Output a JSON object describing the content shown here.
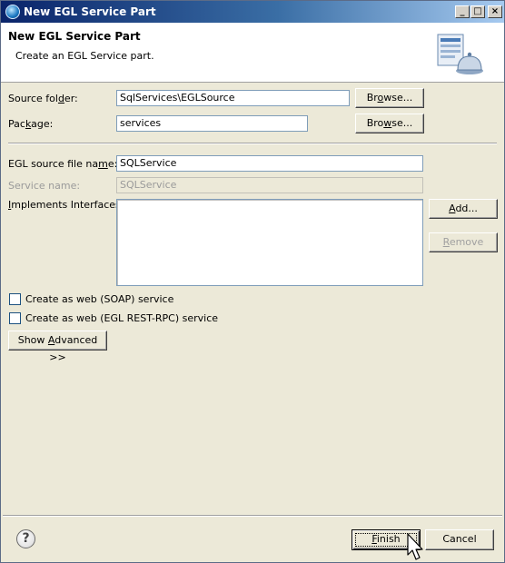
{
  "window": {
    "title": "New EGL Service Part",
    "icon": "egl-app-icon",
    "controls": {
      "minimize": "_",
      "maximize": "□",
      "close": "×"
    }
  },
  "banner": {
    "heading": "New EGL Service Part",
    "description": "Create an EGL Service part.",
    "graphic": "service-bell-icon"
  },
  "form": {
    "source_folder": {
      "label_pre": "Source fol",
      "label_u": "d",
      "label_post": "er:",
      "value": "SqlServices\\EGLSource",
      "browse_pre": "Br",
      "browse_u": "o",
      "browse_post": "wse..."
    },
    "package": {
      "label_pre": "Pac",
      "label_u": "k",
      "label_post": "age:",
      "value": "services",
      "browse_pre": "Bro",
      "browse_u": "w",
      "browse_post": "se..."
    },
    "egl_file": {
      "label_pre": "EGL source file na",
      "label_u": "m",
      "label_post": "e:",
      "value": "SQLService"
    },
    "service_name": {
      "label": "Service name:",
      "value": "SQLService"
    },
    "implements": {
      "label_u": "I",
      "label_post": "mplements Interfaces:",
      "add_pre": "",
      "add_u": "A",
      "add_post": "dd...",
      "remove_pre": "",
      "remove_u": "R",
      "remove_post": "emove"
    },
    "soap_checkbox": {
      "label": "Create as web (SOAP) service",
      "checked": false
    },
    "rest_checkbox": {
      "label": "Create as web (EGL REST-RPC) service",
      "checked": false
    },
    "advanced_button": {
      "pre": "Show ",
      "u": "A",
      "post": "dvanced >>"
    }
  },
  "footer": {
    "help": "?",
    "finish_pre": "",
    "finish_u": "F",
    "finish_post": "inish",
    "cancel": "Cancel"
  }
}
